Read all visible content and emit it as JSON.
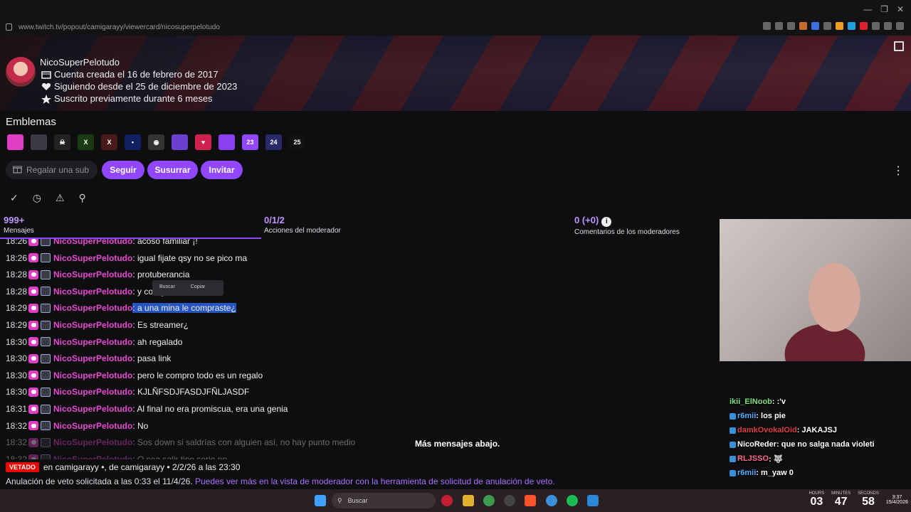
{
  "browser": {
    "url": "www.twitch.tv/popout/camigarayy/viewercard/nicosuperpelotudo",
    "window_controls": [
      "—",
      "❐",
      "✕"
    ]
  },
  "profile": {
    "username": "NicoSuperPelotudo",
    "created": "Cuenta creada el 16 de febrero de 2017",
    "following": "Siguiendo desde el 25 de diciembre de 2023",
    "subscribed": "Suscrito previamente durante 6 meses"
  },
  "emblemas": {
    "title": "Emblemas",
    "badges": [
      {
        "name": "heart-badge",
        "color": "#e03ec4",
        "text": ""
      },
      {
        "name": "sub-badge",
        "color": "#3a3a44",
        "text": ""
      },
      {
        "name": "skull-badge",
        "color": "#222",
        "text": "☠"
      },
      {
        "name": "x-badge-green",
        "color": "#1b3a12",
        "text": "X"
      },
      {
        "name": "x-badge-red",
        "color": "#4a1a1a",
        "text": "X"
      },
      {
        "name": "nasa-badge",
        "color": "#102060",
        "text": "•"
      },
      {
        "name": "controller-badge",
        "color": "#333",
        "text": "◉"
      },
      {
        "name": "purple-badge",
        "color": "#6b3fd1",
        "text": ""
      },
      {
        "name": "heart-pixel-badge",
        "color": "#d02050",
        "text": "♥"
      },
      {
        "name": "purple-box-badge",
        "color": "#8a3ff0",
        "text": ""
      },
      {
        "name": "year-2023-badge",
        "color": "#9147ff",
        "text": "23"
      },
      {
        "name": "year-2024-badge",
        "color": "#2a2a6a",
        "text": "24"
      },
      {
        "name": "year-2025-badge",
        "color": "#111",
        "text": "25"
      }
    ]
  },
  "actions": {
    "gift": "Regalar una sub",
    "follow": "Seguir",
    "whisper": "Susurrar",
    "invite": "Invitar"
  },
  "tabs": [
    {
      "count": "999+",
      "label": "Mensajes"
    },
    {
      "count": "0/1/2",
      "label": "Acciones del moderador"
    },
    {
      "count": "0 (+0)",
      "label": "Comentarios de los moderadores"
    }
  ],
  "messages": [
    {
      "time": "18:26",
      "user": "NicoSuperPelotudo",
      "text": ": acoso familiar ¡!"
    },
    {
      "time": "18:26",
      "user": "NicoSuperPelotudo",
      "text": ": igual fijate qsy no se pico ma"
    },
    {
      "time": "18:28",
      "user": "NicoSuperPelotudo",
      "text": ": protuberancia"
    },
    {
      "time": "18:28",
      "user": "NicoSuperPelotudo",
      "text": ": y co                        ago'"
    },
    {
      "time": "18:29",
      "user": "NicoSuperPelotudo",
      "text": ": a una mina le compraste¿"
    },
    {
      "time": "18:29",
      "user": "NicoSuperPelotudo",
      "text": ": Es streamer¿"
    },
    {
      "time": "18:30",
      "user": "NicoSuperPelotudo",
      "text": ": ah regalado"
    },
    {
      "time": "18:30",
      "user": "NicoSuperPelotudo",
      "text": ": pasa link"
    },
    {
      "time": "18:30",
      "user": "NicoSuperPelotudo",
      "text": ": pero le compro todo es un regalo"
    },
    {
      "time": "18:30",
      "user": "NicoSuperPelotudo",
      "text": ": KJLÑFSDJFASDJFÑLJASDF"
    },
    {
      "time": "18:31",
      "user": "NicoSuperPelotudo",
      "text": ": Al final no era promiscua, era una genia"
    },
    {
      "time": "18:32",
      "user": "NicoSuperPelotudo",
      "text": ": No"
    },
    {
      "time": "18:32",
      "user": "NicoSuperPelotudo",
      "text": ": Sos down si saldrías con alguien así, no hay punto medio"
    },
    {
      "time": "18:32",
      "user": "NicoSuperPelotudo",
      "text": ": O sea salir tipo serio no"
    }
  ],
  "context_menu": {
    "search": "Buscar",
    "copy": "Copiar"
  },
  "more_below": "Más mensajes abajo.",
  "ban": {
    "tag": "VETADO",
    "text": "en camigarayy •, de camigarayy • 2/2/26 a las 23:30",
    "unban_text": "Anulación de veto solicitada a las 0:33 el 11/4/26.",
    "unban_link": "Puedes ver más en la vista de moderador con la herramienta de solicitud de anulación de veto."
  },
  "overlay_chat": [
    {
      "user": "ikii_ElNoob",
      "color": "#7ee07e",
      "text": ": :'v"
    },
    {
      "user": "r6mii",
      "color": "#4fb0ff",
      "text": ": los pie"
    },
    {
      "user": "damkOvokalOid",
      "color": "#e04040",
      "text": ": JAKAJSJ"
    },
    {
      "user": "NicoReder",
      "color": "#ffffff",
      "text": ": que no salga nada violeti"
    },
    {
      "user": "RLJSSO",
      "color": "#ff6a8a",
      "text": ": 🐺"
    },
    {
      "user": "r6mii",
      "color": "#4fb0ff",
      "text": ": m_yaw 0"
    }
  ],
  "taskbar": {
    "search": "Buscar",
    "clock": {
      "hours_label": "HOURS",
      "hours": "03",
      "minutes_label": "MINUTES",
      "minutes": "47",
      "seconds_label": "SECONDS",
      "seconds": "58"
    },
    "time_small": "3:37",
    "date_small": "15/4/2026"
  }
}
